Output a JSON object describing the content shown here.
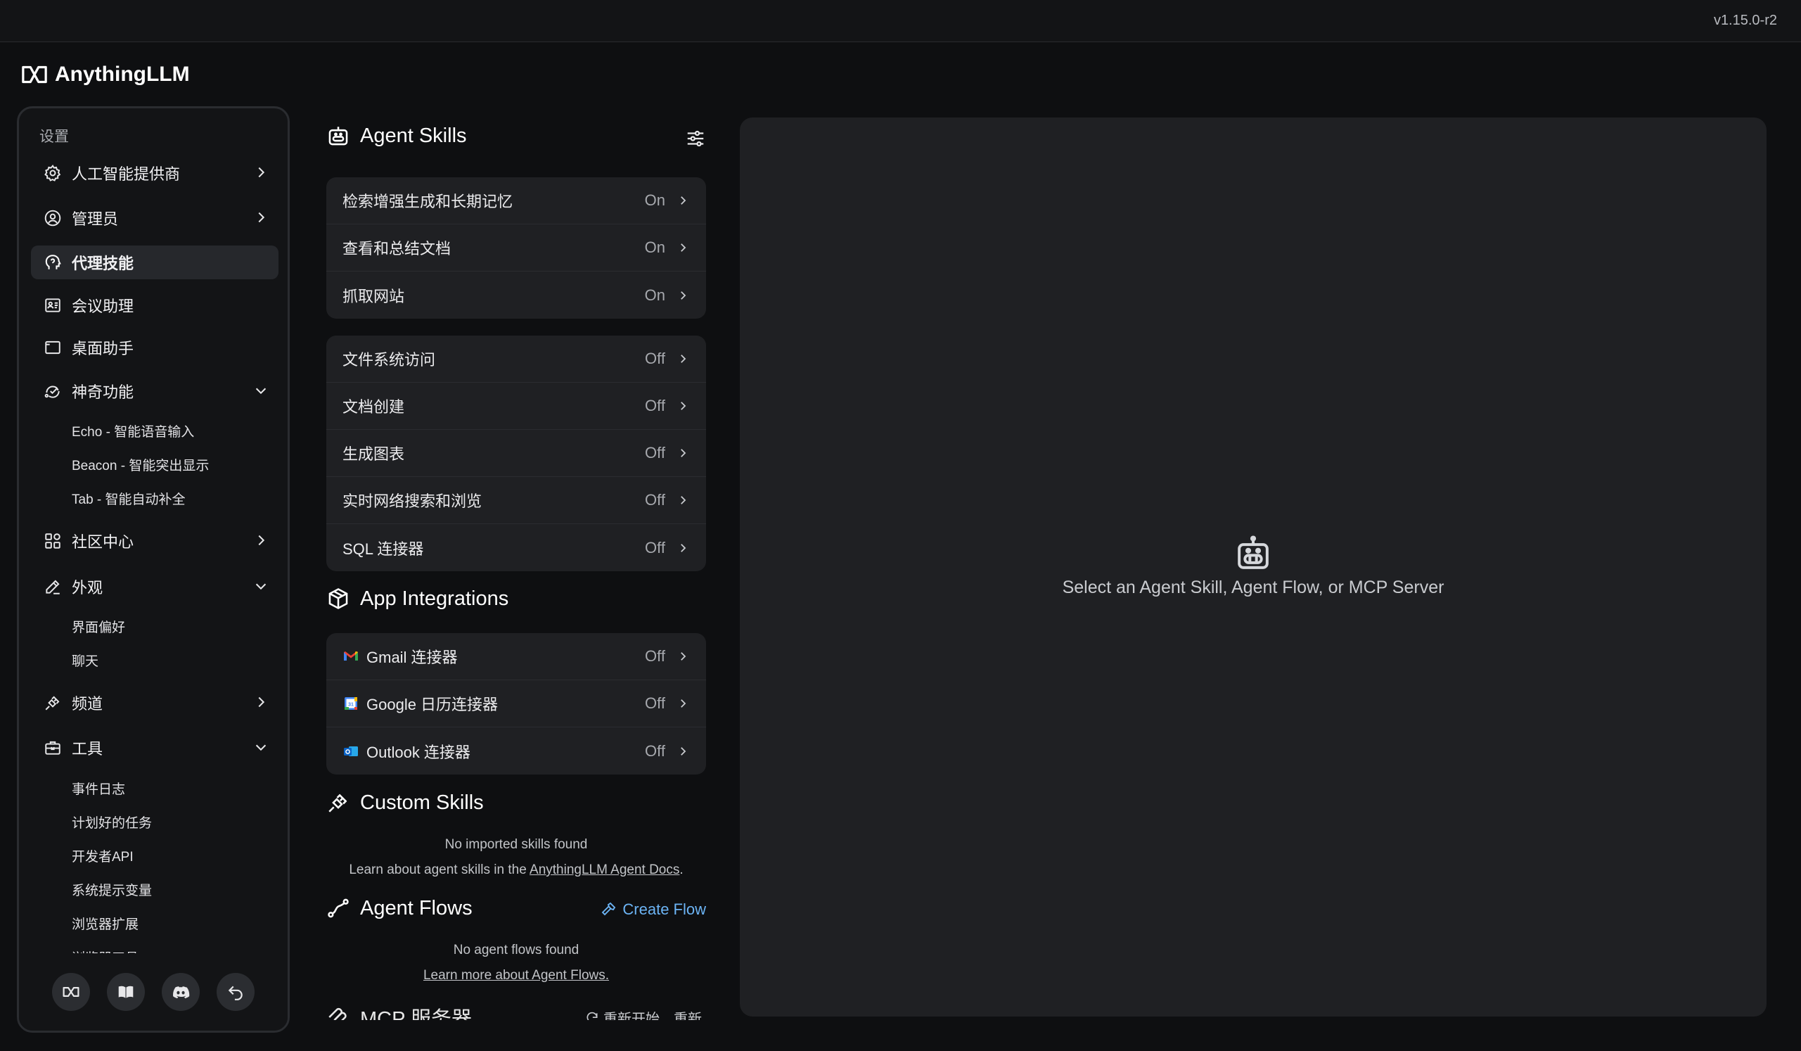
{
  "app": {
    "version": "v1.15.0-r2",
    "brand": "AnythingLLM"
  },
  "sidebar": {
    "heading": "设置",
    "items": [
      {
        "label": "人工智能提供商",
        "icon": "gear-icon",
        "chevron": "right"
      },
      {
        "label": "管理员",
        "icon": "user-gear-icon",
        "chevron": "right"
      },
      {
        "label": "代理技能",
        "icon": "agent-head-icon",
        "active": true
      },
      {
        "label": "会议助理",
        "icon": "meeting-icon"
      },
      {
        "label": "桌面助手",
        "icon": "desktop-icon"
      },
      {
        "label": "神奇功能",
        "icon": "magic-icon",
        "chevron": "down",
        "children": [
          "Echo - 智能语音输入",
          "Beacon - 智能突出显示",
          "Tab - 智能自动补全"
        ]
      },
      {
        "label": "社区中心",
        "icon": "community-icon",
        "chevron": "right"
      },
      {
        "label": "外观",
        "icon": "pencil-icon",
        "chevron": "down",
        "children": [
          "界面偏好",
          "聊天"
        ]
      },
      {
        "label": "频道",
        "icon": "plug-icon",
        "chevron": "right"
      },
      {
        "label": "工具",
        "icon": "toolbox-icon",
        "chevron": "down",
        "children": [
          "事件日志",
          "计划好的任务",
          "开发者API",
          "系统提示变量",
          "浏览器扩展",
          "浏览器工具"
        ]
      }
    ],
    "footer_buttons": [
      "anythingllm-icon",
      "book-icon",
      "discord-icon",
      "back-icon"
    ]
  },
  "agent_skills": {
    "title": "Agent Skills",
    "default_skills": [
      {
        "label": "检索增强生成和长期记忆",
        "status": "On"
      },
      {
        "label": "查看和总结文档",
        "status": "On"
      },
      {
        "label": "抓取网站",
        "status": "On"
      }
    ],
    "optional_skills": [
      {
        "label": "文件系统访问",
        "status": "Off"
      },
      {
        "label": "文档创建",
        "status": "Off"
      },
      {
        "label": "生成图表",
        "status": "Off"
      },
      {
        "label": "实时网络搜索和浏览",
        "status": "Off"
      },
      {
        "label": "SQL 连接器",
        "status": "Off"
      }
    ]
  },
  "app_integrations": {
    "title": "App Integrations",
    "items": [
      {
        "label": "Gmail 连接器",
        "status": "Off",
        "icon": "gmail-icon"
      },
      {
        "label": "Google 日历连接器",
        "status": "Off",
        "icon": "google-calendar-icon"
      },
      {
        "label": "Outlook 连接器",
        "status": "Off",
        "icon": "outlook-icon"
      }
    ]
  },
  "custom_skills": {
    "title": "Custom Skills",
    "empty": "No imported skills found",
    "learn_prefix": "Learn about agent skills in the ",
    "learn_link": "AnythingLLM Agent Docs",
    "learn_suffix": "."
  },
  "agent_flows": {
    "title": "Agent Flows",
    "create_label": "Create Flow",
    "empty": "No agent flows found",
    "learn_link": "Learn more about Agent Flows."
  },
  "mcp": {
    "title": "MCP 服务器",
    "refresh_label": "重新开始，重新"
  },
  "main_panel": {
    "empty_text": "Select an Agent Skill, Agent Flow, or MCP Server"
  },
  "colors": {
    "accent_link": "#6cb4f5",
    "panel": "#1f2023",
    "background": "#0e0f11"
  }
}
